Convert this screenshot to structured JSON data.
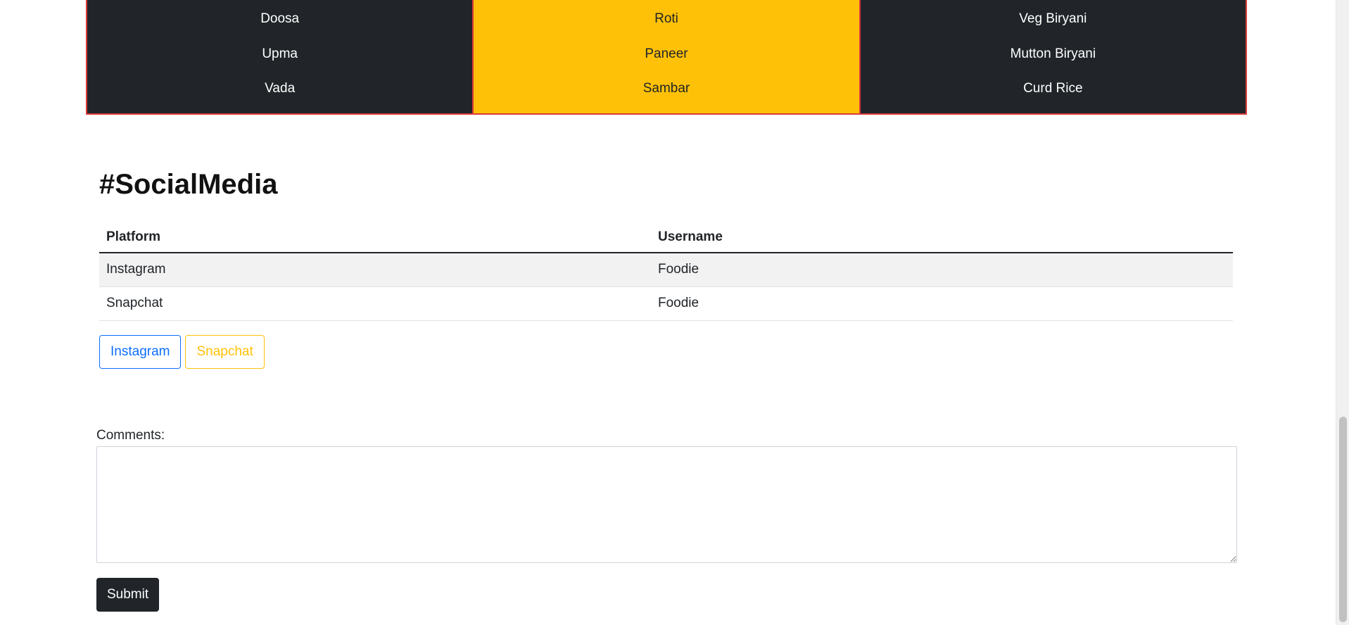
{
  "menu": {
    "columns": [
      {
        "style": "dark",
        "items": [
          "Doosa",
          "Upma",
          "Vada"
        ]
      },
      {
        "style": "yellow",
        "items": [
          "Roti",
          "Paneer",
          "Sambar"
        ]
      },
      {
        "style": "dark",
        "items": [
          "Veg Biryani",
          "Mutton Biryani",
          "Curd Rice"
        ]
      }
    ],
    "colors": {
      "dark": "#212529",
      "yellow": "#ffc107",
      "border": "#d93a3a"
    }
  },
  "social": {
    "title": "#SocialMedia",
    "headers": [
      "Platform",
      "Username"
    ],
    "rows": [
      {
        "platform": "Instagram",
        "username": "Foodie"
      },
      {
        "platform": "Snapchat",
        "username": "Foodie"
      }
    ],
    "buttons": {
      "instagram": "Instagram",
      "snapchat": "Snapchat"
    }
  },
  "form": {
    "comments_label": "Comments:",
    "comments_value": "",
    "submit_label": "Submit"
  }
}
